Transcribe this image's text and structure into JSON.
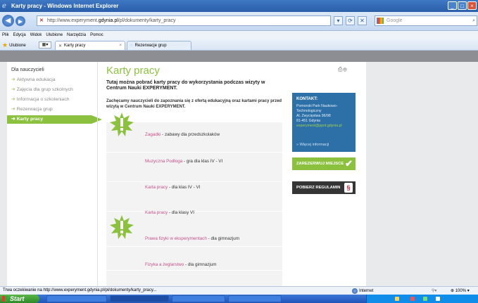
{
  "window": {
    "title": "Karty pracy - Windows Internet Explorer",
    "controls": [
      "_",
      "□",
      "×"
    ]
  },
  "address": {
    "url_prefix": "http://www.experyment.",
    "url_domain": "gdynia.pl",
    "url_suffix": "/pl/dokumenty/karty_pracy",
    "search_placeholder": "Google"
  },
  "menu": [
    "Plik",
    "Edycja",
    "Widok",
    "Ulubione",
    "Narzędzia",
    "Pomoc"
  ],
  "favorites": {
    "label": "Ulubione"
  },
  "tabs": [
    {
      "label": "Karty pracy",
      "active": true
    },
    {
      "label": "Rezerwacje grup",
      "active": false
    }
  ],
  "sidebar": {
    "heading": "Dla nauczycieli",
    "items": [
      {
        "label": "Aktywna edukacja",
        "active": false
      },
      {
        "label": "Zajęcia dla grup szkolnych",
        "active": false
      },
      {
        "label": "Informacja o szkoleniach",
        "active": false
      },
      {
        "label": "Rezerwacja grup",
        "active": false
      },
      {
        "label": "Karty pracy",
        "active": true
      }
    ]
  },
  "main": {
    "title": "Karty pracy",
    "intro_bold": "Tutaj można pobrać karty pracy do wykorzystania podczas wizyty w Centrum Nauki EXPERYMENT.",
    "intro": "Zachęcamy nauczycieli do zapoznania się z ofertą edukacyjną oraz kartami pracy przed wizytą w Centrum Nauki EXPERYMENT.",
    "items": [
      {
        "link": "Zagadki",
        "desc": " - zabawy dla przedszkolaków"
      },
      {
        "link": "Muzyczna Podłoga",
        "desc": " - gra dla klas IV - VI"
      },
      {
        "link": "Karta pracy",
        "desc": " - dla klas IV - VI"
      },
      {
        "link": "Karta pracy",
        "desc": " - dla klasy VI"
      },
      {
        "link": "Prawa fizyki w eksperymentach",
        "desc": " - dla gimnazjum"
      },
      {
        "link": "Fizyka a żeglarstwo",
        "desc": " - dla gimnazjum"
      }
    ]
  },
  "contact": {
    "heading": "KONTAKT:",
    "lines": [
      "Pomorski Park Naukowo-",
      "Technologiczny",
      "Al. Zwycięstwa 96/98",
      "81-451 Gdynia"
    ],
    "email": "experyment@ppnt.gdynia.pl",
    "more": "» Więcej informacji"
  },
  "buttons": {
    "reserve": "ZAREZERWUJ MIEJSCE",
    "regulations": "POBIERZ REGULAMIN"
  },
  "status": {
    "text": "Trwa oczekiwanie na http://www.experyment.gdynia.pl/pl/dokumenty/karty_pracy...",
    "zone": "Internet",
    "zoom": "100%"
  },
  "taskbar": {
    "start": "Start"
  },
  "colors": {
    "accent_green": "#8bc13e",
    "contact_blue": "#2d6fa7",
    "link_pink": "#c2508c"
  }
}
